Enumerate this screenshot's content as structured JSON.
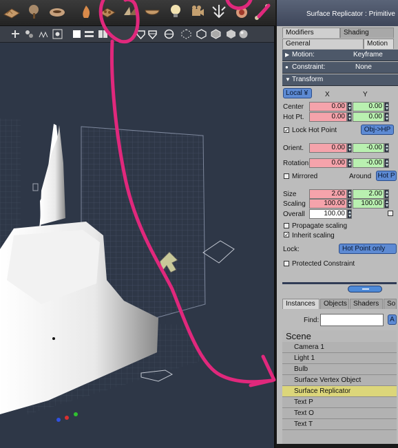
{
  "panel": {
    "title": "Surface Replicator : Primitive",
    "tabs_top": [
      "Modifiers",
      "Shading"
    ],
    "tabs_sub": [
      "General",
      "Motion"
    ],
    "motion": {
      "label": "Motion:",
      "value": "Keyframe"
    },
    "constraint": {
      "label": "Constraint:",
      "value": "None"
    },
    "transform": {
      "label": "Transform"
    },
    "coord_space": "Local",
    "col_x": "X",
    "col_y": "Y",
    "center": {
      "label": "Center",
      "x": "0.00",
      "y": "0.00"
    },
    "hotpt": {
      "label": "Hot Pt.",
      "x": "0.00",
      "y": "0.00"
    },
    "lock_hot_point": {
      "label": "Lock Hot Point",
      "checked": true
    },
    "obj_hp_button": "Obj->HP",
    "orient": {
      "label": "Orient.",
      "x": "0.00",
      "y": "-0.00"
    },
    "rotation": {
      "label": "Rotation",
      "x": "0.00",
      "y": "-0.00"
    },
    "mirrored": {
      "label": "Mirrored",
      "checked": false
    },
    "around_label": "Around",
    "hot_button": "Hot P",
    "size": {
      "label": "Size",
      "x": "2.00",
      "y": "2.00"
    },
    "scaling": {
      "label": "Scaling",
      "x": "100.00",
      "y": "100.00"
    },
    "overall": {
      "label": "Overall",
      "value": "100.00"
    },
    "propagate_scaling": {
      "label": "Propagate scaling",
      "checked": false
    },
    "inherit_scaling": {
      "label": "Inherit scaling",
      "checked": true
    },
    "lock": {
      "label": "Lock:",
      "value": "Hot Point only"
    },
    "protected_constraint": {
      "label": "Protected Constraint",
      "checked": false
    }
  },
  "browser": {
    "tabs": [
      "Instances",
      "Objects",
      "Shaders",
      "So"
    ],
    "find_label": "Find:",
    "scene_header": "Scene",
    "items": [
      "Camera 1",
      "Light 1",
      "Bulb",
      "Surface Vertex Object",
      "Surface Replicator",
      "Text P",
      "Text O",
      "Text T"
    ],
    "selected_index": 4
  },
  "toolbar": {
    "icons": [
      "terrain-icon",
      "tree-icon",
      "cloud-icon",
      "fire-icon",
      "replicator-icon",
      "scatter-icon",
      "bowl-icon",
      "bulb-icon",
      "camera-icon",
      "arrows-icon",
      "target-icon",
      "bone-icon"
    ]
  },
  "viewport": {
    "icons": [
      "move-icon",
      "lights-icon",
      "group-icon",
      "dots-icon",
      "square-icon",
      "lines-icon",
      "boxes-icon",
      "shield-icon",
      "shield2-icon",
      "sphere-icon",
      "dotted-cube-icon",
      "cube-icon",
      "cube2-icon",
      "ball-icon"
    ]
  },
  "colors": {
    "annotation": "#e0287c",
    "selection": "#dcd67a",
    "viewport_bg": "#2e3747"
  }
}
